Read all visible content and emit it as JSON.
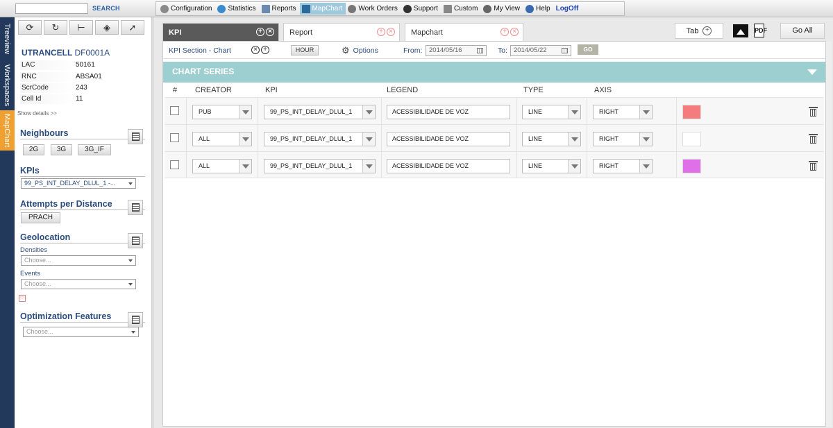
{
  "topbar": {
    "search_button": "SEARCH",
    "menu": [
      {
        "label": "Configuration",
        "icon": "config-icon",
        "color": "#8a8a8a"
      },
      {
        "label": "Statistics",
        "icon": "statistics-icon",
        "color": "#3a8ad0"
      },
      {
        "label": "Reports",
        "icon": "reports-icon",
        "color": "#6a8ab0"
      },
      {
        "label": "MapChart",
        "icon": "mapchart-icon",
        "color": "#2b6a9a",
        "active": true
      },
      {
        "label": "Work Orders",
        "icon": "work-orders-icon",
        "color": "#777"
      },
      {
        "label": "Support",
        "icon": "support-icon",
        "color": "#333"
      },
      {
        "label": "Custom",
        "icon": "custom-icon",
        "color": "#888"
      },
      {
        "label": "My View",
        "icon": "my-view-icon",
        "color": "#666"
      },
      {
        "label": "Help",
        "icon": "help-icon",
        "color": "#3a6ab0"
      },
      {
        "label": "LogOff",
        "logoff": true
      }
    ]
  },
  "vertical_tabs": [
    "Treeview",
    "Workspaces",
    "MapChart"
  ],
  "sidebar": {
    "cell_title": "UTRANCELL",
    "cell_id": "DF0001A",
    "properties": [
      {
        "label": "LAC",
        "value": "50161"
      },
      {
        "label": "RNC",
        "value": "ABSA01"
      },
      {
        "label": "ScrCode",
        "value": "243"
      },
      {
        "label": "Cell Id",
        "value": "11"
      }
    ],
    "show_details": "Show details >>",
    "neighbours": {
      "title": "Neighbours",
      "buttons": [
        "2G",
        "3G",
        "3G_IF"
      ]
    },
    "kpis": {
      "title": "KPIs",
      "selected": "99_PS_INT_DELAY_DLUL_1 -..."
    },
    "attempts": {
      "title": "Attempts per Distance",
      "button": "PRACH"
    },
    "geolocation": {
      "title": "Geolocation",
      "densities_label": "Densities",
      "densities_placeholder": "Choose...",
      "events_label": "Events",
      "events_placeholder": "Choose..."
    },
    "optimization": {
      "title": "Optimization Features",
      "placeholder": "Choose..."
    }
  },
  "tabs": [
    {
      "label": "KPI",
      "active": true
    },
    {
      "label": "Report"
    },
    {
      "label": "Mapchart"
    }
  ],
  "right_buttons": {
    "tab": "Tab",
    "go_all": "Go All",
    "pdf": "PDF"
  },
  "subbar": {
    "section": "KPI Section - Chart",
    "hour": "HOUR",
    "options": "Options",
    "from_label": "From:",
    "from_value": "2014/05/16",
    "to_label": "To:",
    "to_value": "2014/05/22",
    "go": "GO"
  },
  "series": {
    "header": "CHART SERIES",
    "columns": [
      "#",
      "CREATOR",
      "KPI",
      "LEGEND",
      "TYPE",
      "AXIS"
    ],
    "rows": [
      {
        "creator": "PUB",
        "kpi": "99_PS_INT_DELAY_DLUL_1",
        "legend": "ACESSIBILIDADE DE VOZ",
        "type": "LINE",
        "axis": "RIGHT",
        "color": "#f57c7c"
      },
      {
        "creator": "ALL",
        "kpi": "99_PS_INT_DELAY_DLUL_1",
        "legend": "ACESSIBILIDADE DE VOZ",
        "type": "LINE",
        "axis": "RIGHT",
        "color": "#ffffff"
      },
      {
        "creator": "ALL",
        "kpi": "99_PS_INT_DELAY_DLUL_1",
        "legend": "ACESSIBILIDADE DE VOZ",
        "type": "LINE",
        "axis": "RIGHT",
        "color": "#e070e8"
      }
    ]
  }
}
